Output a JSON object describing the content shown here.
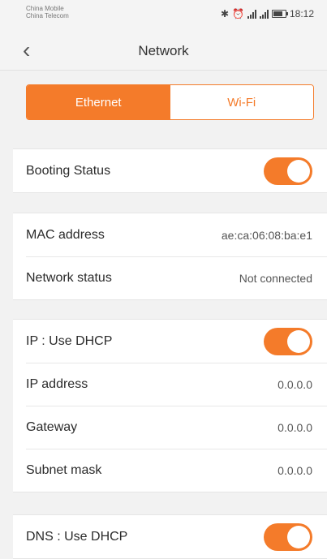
{
  "status_bar": {
    "carrier1": "China Mobile",
    "carrier2": "China Telecom",
    "icons": [
      "bluetooth-icon",
      "alarm-icon",
      "signal-icon",
      "signal-icon",
      "battery-icon"
    ],
    "time": "18:12"
  },
  "header": {
    "back_icon": "chevron-left-icon",
    "title": "Network"
  },
  "segment": {
    "ethernet_label": "Ethernet",
    "wifi_label": "Wi-Fi",
    "selected": "Ethernet"
  },
  "booting": {
    "label": "Booting Status",
    "enabled": true
  },
  "info": {
    "mac_label": "MAC address",
    "mac_value": "ae:ca:06:08:ba:e1",
    "network_label": "Network status",
    "network_value": "Not connected"
  },
  "ip": {
    "dhcp_label": "IP : Use DHCP",
    "dhcp_enabled": true,
    "address_label": "IP address",
    "address_value": "0.0.0.0",
    "gateway_label": "Gateway",
    "gateway_value": "0.0.0.0",
    "subnet_label": "Subnet mask",
    "subnet_value": "0.0.0.0"
  },
  "dns": {
    "dhcp_label": "DNS : Use DHCP",
    "dhcp_enabled": true
  },
  "colors": {
    "accent": "#f47b2a",
    "background": "#f2f2f2"
  }
}
